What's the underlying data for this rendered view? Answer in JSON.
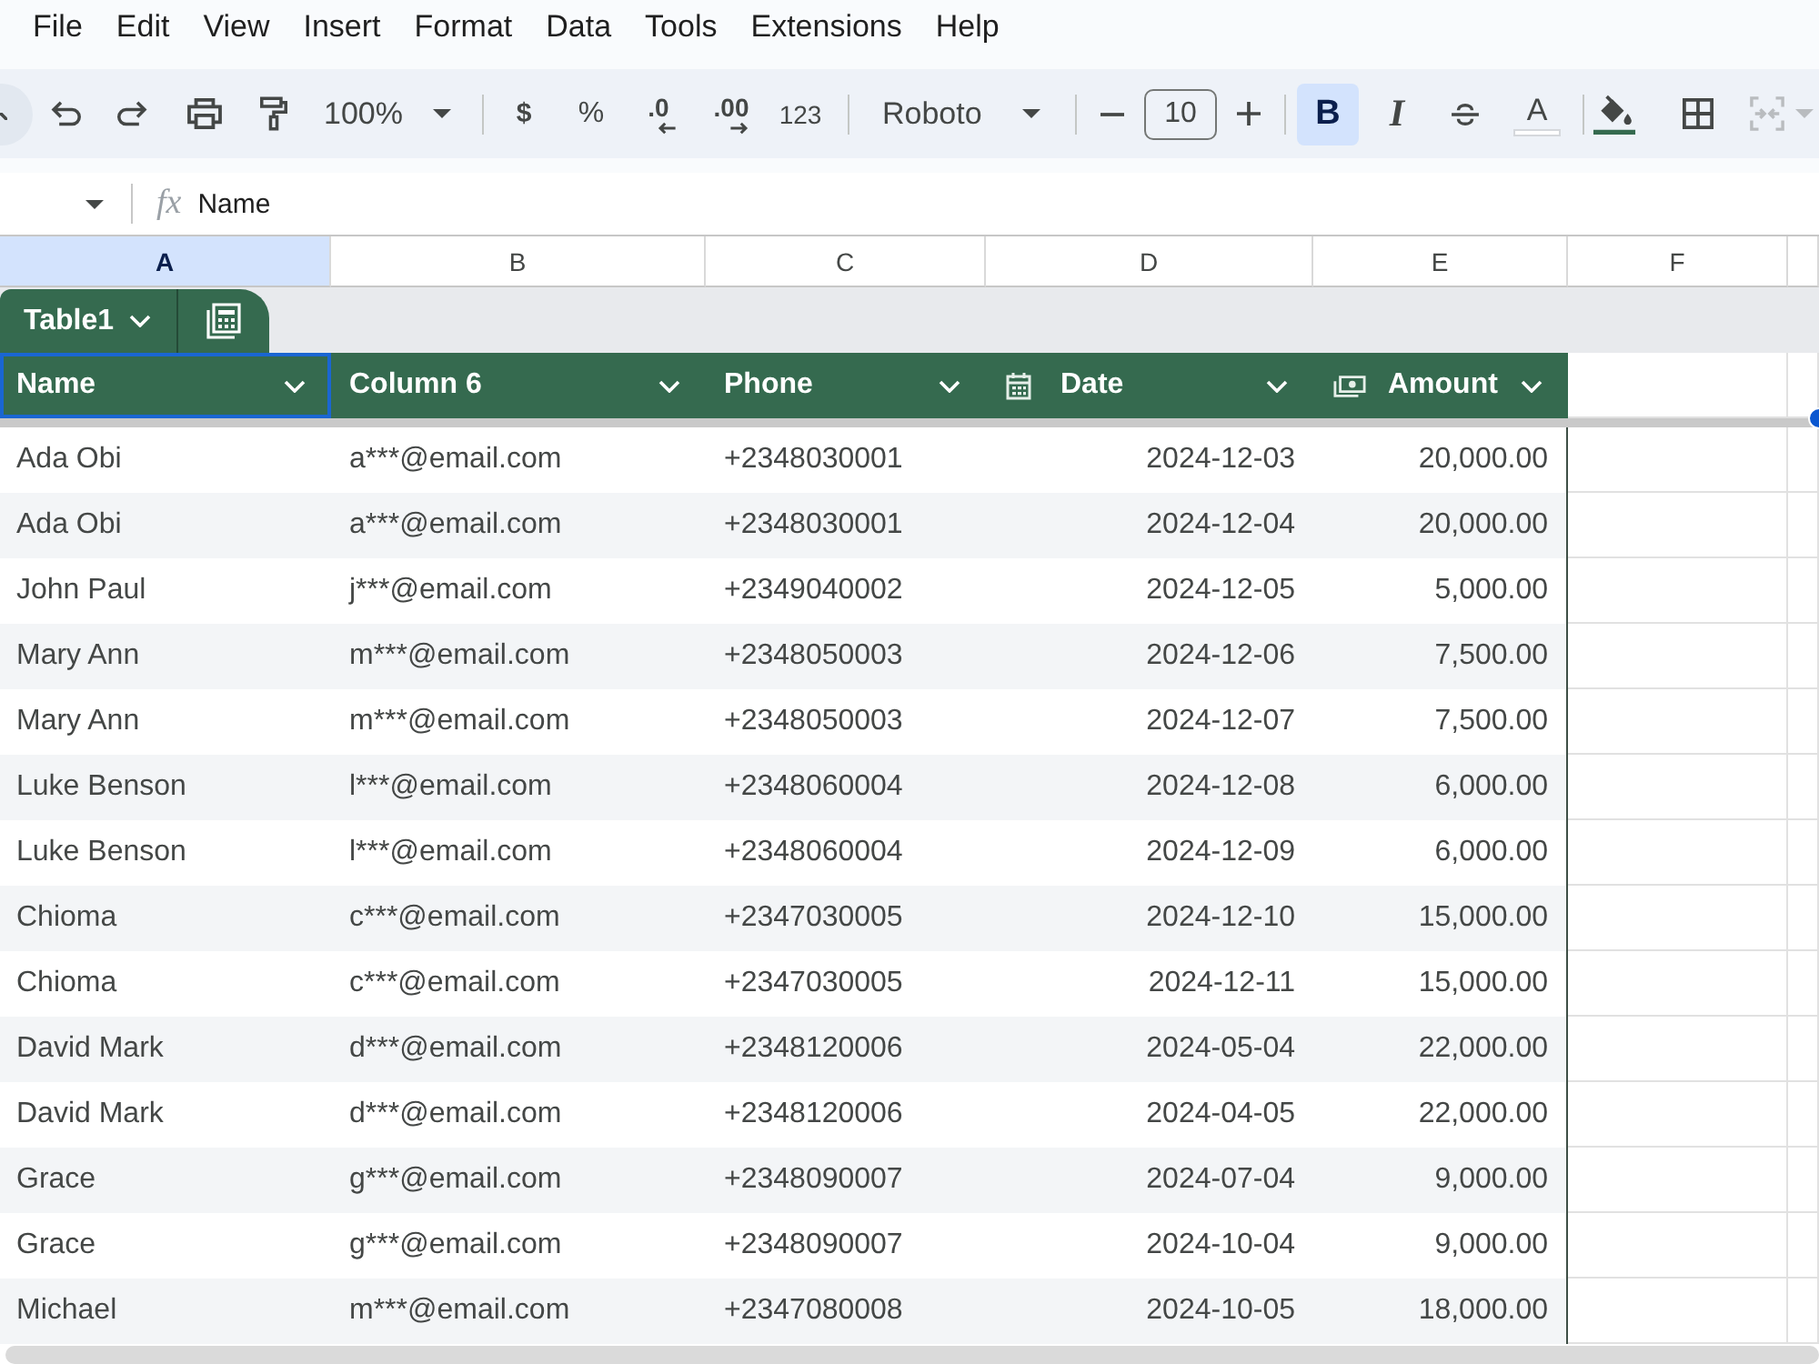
{
  "menu_bar": [
    "File",
    "Edit",
    "View",
    "Insert",
    "Format",
    "Data",
    "Tools",
    "Extensions",
    "Help"
  ],
  "toolbar": {
    "zoom": "100%",
    "currency": "$",
    "percent": "%",
    "decrease_decimal": ".0",
    "increase_decimal": ".00",
    "number_format": "123",
    "font": "Roboto",
    "font_size": "10",
    "styles": [
      {
        "kind": "bold",
        "label": "B",
        "selected": true
      },
      {
        "kind": "italic",
        "label": "I",
        "selected": false
      }
    ],
    "text_color": "A",
    "merge": {
      "disabled": true
    }
  },
  "formula_bar": {
    "function_label": "fx",
    "value": "Name"
  },
  "column_headers": [
    {
      "label": "A",
      "selected": true
    },
    {
      "label": "B",
      "selected": false
    },
    {
      "label": "C",
      "selected": false
    },
    {
      "label": "D",
      "selected": false
    },
    {
      "label": "E",
      "selected": false
    },
    {
      "label": "F",
      "selected": false
    }
  ],
  "table": {
    "name": "Table1",
    "columns": [
      {
        "label": "Name",
        "kind": "text",
        "selected": true
      },
      {
        "label": "Column 6",
        "kind": "text",
        "selected": false
      },
      {
        "label": "Phone",
        "kind": "text",
        "selected": false
      },
      {
        "label": "Date",
        "kind": "date",
        "selected": false
      },
      {
        "label": "Amount",
        "kind": "currency",
        "selected": false
      }
    ],
    "rows": [
      [
        "Ada Obi",
        "a***@email.com",
        "+2348030001",
        "2024-12-03",
        "20,000.00"
      ],
      [
        "Ada Obi",
        "a***@email.com",
        "+2348030001",
        "2024-12-04",
        "20,000.00"
      ],
      [
        "John Paul",
        "j***@email.com",
        "+2349040002",
        "2024-12-05",
        "5,000.00"
      ],
      [
        "Mary Ann",
        "m***@email.com",
        "+2348050003",
        "2024-12-06",
        "7,500.00"
      ],
      [
        "Mary Ann",
        "m***@email.com",
        "+2348050003",
        "2024-12-07",
        "7,500.00"
      ],
      [
        "Luke Benson",
        "l***@email.com",
        "+2348060004",
        "2024-12-08",
        "6,000.00"
      ],
      [
        "Luke Benson",
        "l***@email.com",
        "+2348060004",
        "2024-12-09",
        "6,000.00"
      ],
      [
        "Chioma",
        "c***@email.com",
        "+2347030005",
        "2024-12-10",
        "15,000.00"
      ],
      [
        "Chioma",
        "c***@email.com",
        "+2347030005",
        "2024-12-11",
        "15,000.00"
      ],
      [
        "David Mark",
        "d***@email.com",
        "+2348120006",
        "2024-05-04",
        "22,000.00"
      ],
      [
        "David Mark",
        "d***@email.com",
        "+2348120006",
        "2024-04-05",
        "22,000.00"
      ],
      [
        "Grace",
        "g***@email.com",
        "+2348090007",
        "2024-07-04",
        "9,000.00"
      ],
      [
        "Grace",
        "g***@email.com",
        "+2348090007",
        "2024-10-04",
        "9,000.00"
      ],
      [
        "Michael",
        "m***@email.com",
        "+2347080008",
        "2024-10-05",
        "18,000.00"
      ]
    ]
  }
}
